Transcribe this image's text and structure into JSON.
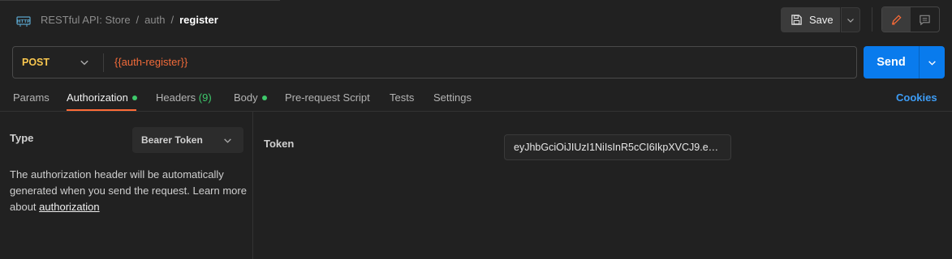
{
  "breadcrumb": {
    "collection": "RESTful API: Store",
    "folder": "auth",
    "request": "register",
    "separator": "/"
  },
  "header": {
    "save_label": "Save",
    "http_icon": "http-icon"
  },
  "request": {
    "method": "POST",
    "url": "{{auth-register}}",
    "send_label": "Send"
  },
  "tabs": {
    "params": "Params",
    "authorization": "Authorization",
    "headers": "Headers",
    "headers_count": "(9)",
    "body": "Body",
    "prerequest": "Pre-request Script",
    "tests": "Tests",
    "settings": "Settings",
    "cookies": "Cookies"
  },
  "auth": {
    "type_label": "Type",
    "type_value": "Bearer Token",
    "description": "The authorization header will be automatically generated when you send the request. Learn more about ",
    "link": "authorization",
    "token_label": "Token",
    "token_value": "eyJhbGciOiJIUzI1NiIsInR5cCI6IkpXVCJ9.eyJ..."
  },
  "colors": {
    "accent": "#ff6c37",
    "send": "#097bed",
    "method": "#f9c74f",
    "variable": "#f26b3a",
    "status_dot": "#3ec96b",
    "link": "#3d9cf5"
  }
}
